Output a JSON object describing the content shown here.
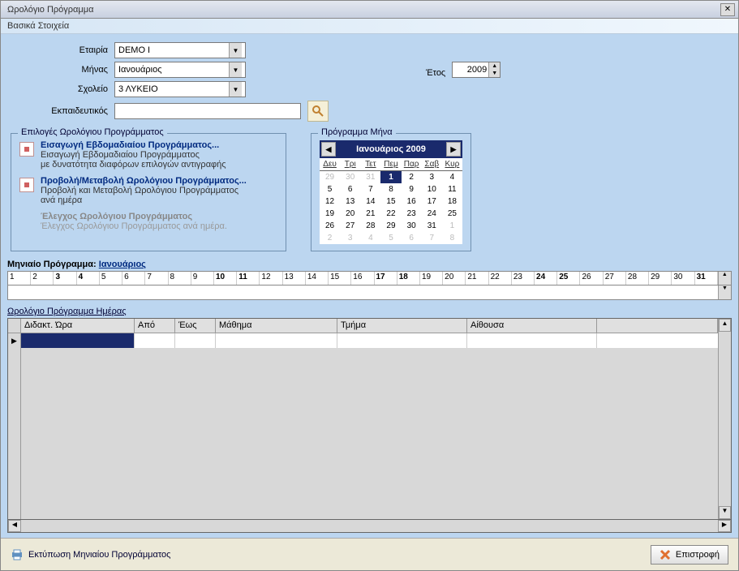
{
  "window": {
    "title": "Ωρολόγιο Πρόγραμμα"
  },
  "section": {
    "basic": "Βασικά Στοιχεία"
  },
  "form": {
    "company_label": "Εταιρία",
    "company_value": "DEMO I",
    "month_label": "Μήνας",
    "month_value": "Ιανουάριος",
    "year_label": "Έτος",
    "year_value": "2009",
    "school_label": "Σχολείο",
    "school_value": "3 ΛΥΚΕΙΟ",
    "teacher_label": "Εκπαιδευτικός",
    "teacher_value": ""
  },
  "options": {
    "legend": "Επιλογές Ωρολόγιου Προγράμματος",
    "item1_title": "Εισαγωγή Εβδομαδιαίου Προγράμματος...",
    "item1_desc1": "Εισαγωγή Εβδομαδιαίου Προγράμματος",
    "item1_desc2": "με δυνατότητα διαφόρων επιλογών αντιγραφής",
    "item2_title": "Προβολή/Μεταβολή Ωρολόγιου Προγράμματος...",
    "item2_desc1": "Προβολή και Μεταβολή Ωρολόγιου Προγράμματος",
    "item2_desc2": "ανά ημέρα",
    "item3_title": "Έλεγχος Ωρολόγιου Προγράμματος",
    "item3_desc": "Έλεγχος Ωρολόγιου Προγράμματος ανά ημέρα."
  },
  "calendar": {
    "legend": "Πρόγραμμα Μήνα",
    "header": "Ιανουάριος 2009",
    "dow": [
      "Δευ",
      "Τρι",
      "Τετ",
      "Πεμ",
      "Παρ",
      "Σαβ",
      "Κυρ"
    ],
    "weeks": [
      [
        {
          "d": "29",
          "o": true
        },
        {
          "d": "30",
          "o": true
        },
        {
          "d": "31",
          "o": true
        },
        {
          "d": "1",
          "sel": true
        },
        {
          "d": "2"
        },
        {
          "d": "3"
        },
        {
          "d": "4"
        }
      ],
      [
        {
          "d": "5"
        },
        {
          "d": "6"
        },
        {
          "d": "7"
        },
        {
          "d": "8"
        },
        {
          "d": "9"
        },
        {
          "d": "10"
        },
        {
          "d": "11"
        }
      ],
      [
        {
          "d": "12"
        },
        {
          "d": "13"
        },
        {
          "d": "14"
        },
        {
          "d": "15"
        },
        {
          "d": "16"
        },
        {
          "d": "17"
        },
        {
          "d": "18"
        }
      ],
      [
        {
          "d": "19"
        },
        {
          "d": "20"
        },
        {
          "d": "21"
        },
        {
          "d": "22"
        },
        {
          "d": "23"
        },
        {
          "d": "24"
        },
        {
          "d": "25"
        }
      ],
      [
        {
          "d": "26"
        },
        {
          "d": "27"
        },
        {
          "d": "28"
        },
        {
          "d": "29"
        },
        {
          "d": "30"
        },
        {
          "d": "31"
        },
        {
          "d": "1",
          "o": true
        }
      ],
      [
        {
          "d": "2",
          "o": true
        },
        {
          "d": "3",
          "o": true
        },
        {
          "d": "4",
          "o": true
        },
        {
          "d": "5",
          "o": true
        },
        {
          "d": "6",
          "o": true
        },
        {
          "d": "7",
          "o": true
        },
        {
          "d": "8",
          "o": true
        }
      ]
    ]
  },
  "monthly": {
    "label": "Μηνιαίο Πρόγραμμα:",
    "month_link": "Ιανουάριος",
    "days": [
      {
        "n": "1",
        "b": false
      },
      {
        "n": "2",
        "b": false
      },
      {
        "n": "3",
        "b": true
      },
      {
        "n": "4",
        "b": true
      },
      {
        "n": "5",
        "b": false
      },
      {
        "n": "6",
        "b": false
      },
      {
        "n": "7",
        "b": false
      },
      {
        "n": "8",
        "b": false
      },
      {
        "n": "9",
        "b": false
      },
      {
        "n": "10",
        "b": true
      },
      {
        "n": "11",
        "b": true
      },
      {
        "n": "12",
        "b": false
      },
      {
        "n": "13",
        "b": false
      },
      {
        "n": "14",
        "b": false
      },
      {
        "n": "15",
        "b": false
      },
      {
        "n": "16",
        "b": false
      },
      {
        "n": "17",
        "b": true
      },
      {
        "n": "18",
        "b": true
      },
      {
        "n": "19",
        "b": false
      },
      {
        "n": "20",
        "b": false
      },
      {
        "n": "21",
        "b": false
      },
      {
        "n": "22",
        "b": false
      },
      {
        "n": "23",
        "b": false
      },
      {
        "n": "24",
        "b": true
      },
      {
        "n": "25",
        "b": true
      },
      {
        "n": "26",
        "b": false
      },
      {
        "n": "27",
        "b": false
      },
      {
        "n": "28",
        "b": false
      },
      {
        "n": "29",
        "b": false
      },
      {
        "n": "30",
        "b": false
      },
      {
        "n": "31",
        "b": true
      }
    ]
  },
  "grid": {
    "title": "Ωρολόγιο Πρόγραμμα Ημέρας",
    "cols": {
      "c1": "Διδακτ. Ώρα",
      "c2": "Από",
      "c3": "Έως",
      "c4": "Μάθημα",
      "c5": "Τμήμα",
      "c6": "Αίθουσα"
    }
  },
  "footer": {
    "print": "Εκτύπωση Μηνιαίου Προγράμματος",
    "back": "Επιστροφή"
  }
}
